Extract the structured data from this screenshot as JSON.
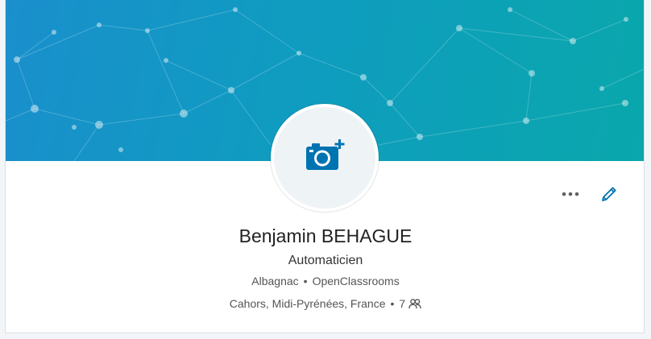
{
  "profile": {
    "name": "Benjamin BEHAGUE",
    "headline": "Automaticien",
    "current_position": "Albagnac",
    "education": "OpenClassrooms",
    "location": "Cahors, Midi-Pyrénées, France",
    "connections": "7",
    "separator": "•"
  },
  "icons": {
    "avatar_placeholder": "add-photo-camera-icon",
    "more": "more-dots-icon",
    "edit": "pencil-icon",
    "connections": "people-icon"
  },
  "colors": {
    "accent": "#0073b1",
    "banner_start": "#1a8fcc",
    "banner_end": "#0aa7ac",
    "dots": "#5f6163"
  }
}
